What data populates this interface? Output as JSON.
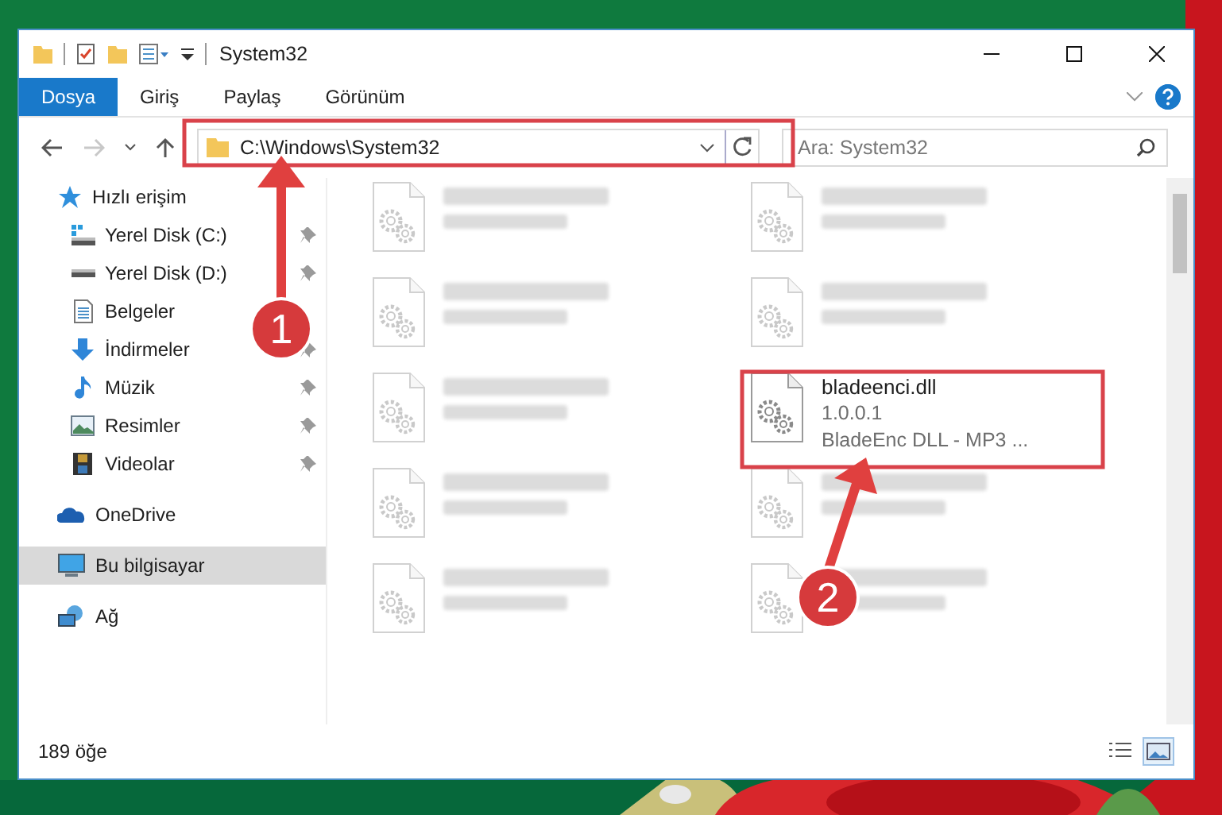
{
  "window": {
    "title": "System32"
  },
  "ribbon": {
    "tabs": [
      {
        "label": "Dosya",
        "selected": true
      },
      {
        "label": "Giriş",
        "selected": false
      },
      {
        "label": "Paylaş",
        "selected": false
      },
      {
        "label": "Görünüm",
        "selected": false
      }
    ]
  },
  "navigation": {
    "back_disabled": false,
    "forward_disabled": true
  },
  "address_bar": {
    "value": "C:\\Windows\\System32"
  },
  "search": {
    "placeholder": "Ara: System32"
  },
  "sidebar": {
    "items": [
      {
        "label": "Hızlı erişim",
        "kind": "star",
        "selected": false,
        "children": [
          {
            "label": "Yerel Disk (C:)",
            "kind": "drive-system",
            "pinned": true,
            "selected": false
          },
          {
            "label": "Yerel Disk (D:)",
            "kind": "drive",
            "pinned": true,
            "selected": false
          },
          {
            "label": "Belgeler",
            "kind": "document",
            "pinned": false,
            "selected": false
          },
          {
            "label": "İndirmeler",
            "kind": "download",
            "pinned": true,
            "selected": false
          },
          {
            "label": "Müzik",
            "kind": "music",
            "pinned": true,
            "selected": false
          },
          {
            "label": "Resimler",
            "kind": "pictures",
            "pinned": true,
            "selected": false
          },
          {
            "label": "Videolar",
            "kind": "video",
            "pinned": true,
            "selected": false
          }
        ]
      },
      {
        "label": "OneDrive",
        "kind": "cloud",
        "selected": false
      },
      {
        "label": "Bu bilgisayar",
        "kind": "computer",
        "selected": true
      },
      {
        "label": "Ağ",
        "kind": "network",
        "selected": false
      }
    ]
  },
  "files": [
    {
      "blurred": true
    },
    {
      "blurred": true
    },
    {
      "blurred": true
    },
    {
      "blurred": true
    },
    {
      "blurred": true
    },
    {
      "name": "bladeenci.dll",
      "lines": [
        "1.0.0.1",
        "BladeEnc DLL - MP3 ..."
      ],
      "blurred": false
    },
    {
      "blurred": true
    },
    {
      "blurred": true
    },
    {
      "blurred": true
    },
    {
      "blurred": true
    }
  ],
  "status_bar": {
    "item_count": "189 öğe",
    "views": [
      {
        "kind": "details",
        "selected": false
      },
      {
        "kind": "large-icons",
        "selected": true
      }
    ]
  },
  "annotations": [
    {
      "label": "1"
    },
    {
      "label": "2"
    }
  ]
}
